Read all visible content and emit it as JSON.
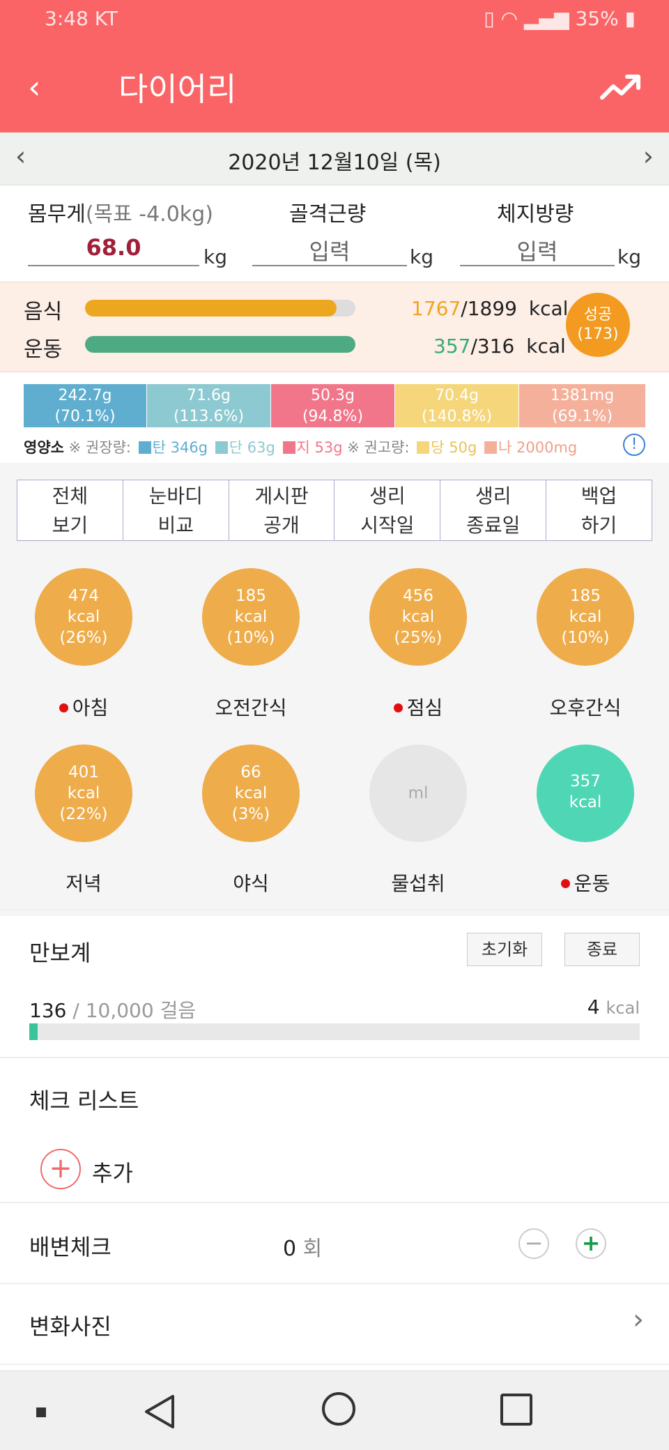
{
  "status": {
    "time": "3:48 KT",
    "battery": "35%"
  },
  "header": {
    "title": "다이어리"
  },
  "date": {
    "label": "2020년 12월10일 (목)"
  },
  "measures": {
    "weight_label": "몸무게",
    "weight_goal": "(목표 -4.0kg)",
    "weight_value": "68.0",
    "muscle_label": "골격근량",
    "muscle_value": "입력",
    "fat_label": "체지방량",
    "fat_value": "입력",
    "unit": "kg"
  },
  "calories": {
    "food_label": "음식",
    "food_current": "1767",
    "food_target": "/1899",
    "food_progress": 0.93,
    "exercise_label": "운동",
    "exercise_current": "357",
    "exercise_target": "/316",
    "exercise_progress": 1.0,
    "unit": "kcal",
    "success_label": "성공",
    "success_count": "(173)"
  },
  "nutrients": [
    {
      "amount": "242.7g",
      "pct": "(70.1%)",
      "color": "#5faed0"
    },
    {
      "amount": "71.6g",
      "pct": "(113.6%)",
      "color": "#8cc9d0"
    },
    {
      "amount": "50.3g",
      "pct": "(94.8%)",
      "color": "#f2768a"
    },
    {
      "amount": "70.4g",
      "pct": "(140.8%)",
      "color": "#f5d67a"
    },
    {
      "amount": "1381mg",
      "pct": "(69.1%)",
      "color": "#f4b09a"
    }
  ],
  "nutrient_legend": {
    "title": "영양소",
    "recommend": "※ 권장량:",
    "carb": "탄 346g",
    "protein": "단 63g",
    "fat": "지 53g",
    "warn": "※ 권고량:",
    "sugar": "당 50g",
    "sodium": "나 2000mg"
  },
  "tabs": [
    {
      "line1": "전체",
      "line2": "보기"
    },
    {
      "line1": "눈바디",
      "line2": "비교"
    },
    {
      "line1": "게시판",
      "line2": "공개"
    },
    {
      "line1": "생리",
      "line2": "시작일"
    },
    {
      "line1": "생리",
      "line2": "종료일"
    },
    {
      "line1": "백업",
      "line2": "하기"
    }
  ],
  "meals": [
    {
      "kcal": "474",
      "unit": "kcal",
      "pct": "(26%)",
      "label": "아침",
      "dot": true
    },
    {
      "kcal": "185",
      "unit": "kcal",
      "pct": "(10%)",
      "label": "오전간식",
      "dot": false
    },
    {
      "kcal": "456",
      "unit": "kcal",
      "pct": "(25%)",
      "label": "점심",
      "dot": true
    },
    {
      "kcal": "185",
      "unit": "kcal",
      "pct": "(10%)",
      "label": "오후간식",
      "dot": false
    },
    {
      "kcal": "401",
      "unit": "kcal",
      "pct": "(22%)",
      "label": "저녁",
      "dot": false
    },
    {
      "kcal": "66",
      "unit": "kcal",
      "pct": "(3%)",
      "label": "야식",
      "dot": false
    },
    {
      "kcal": "ml",
      "unit": "",
      "pct": "",
      "label": "물섭취",
      "dot": false
    },
    {
      "kcal": "357",
      "unit": "kcal",
      "pct": "",
      "label": "운동",
      "dot": true
    }
  ],
  "pedometer": {
    "title": "만보계",
    "reset": "초기화",
    "stop": "종료",
    "steps": "136",
    "goal": "/ 10,000 걸음",
    "kcal_value": "4",
    "kcal_unit": "kcal",
    "progress": 0.0136
  },
  "checklist": {
    "title": "체크 리스트",
    "add": "추가"
  },
  "bowel": {
    "title": "배변체크",
    "count": "0",
    "unit": "회"
  },
  "photos": {
    "title": "변화사진"
  },
  "colors": {
    "accent": "#fb6466",
    "orange": "#eeac4a",
    "green": "#4fd6b4"
  }
}
